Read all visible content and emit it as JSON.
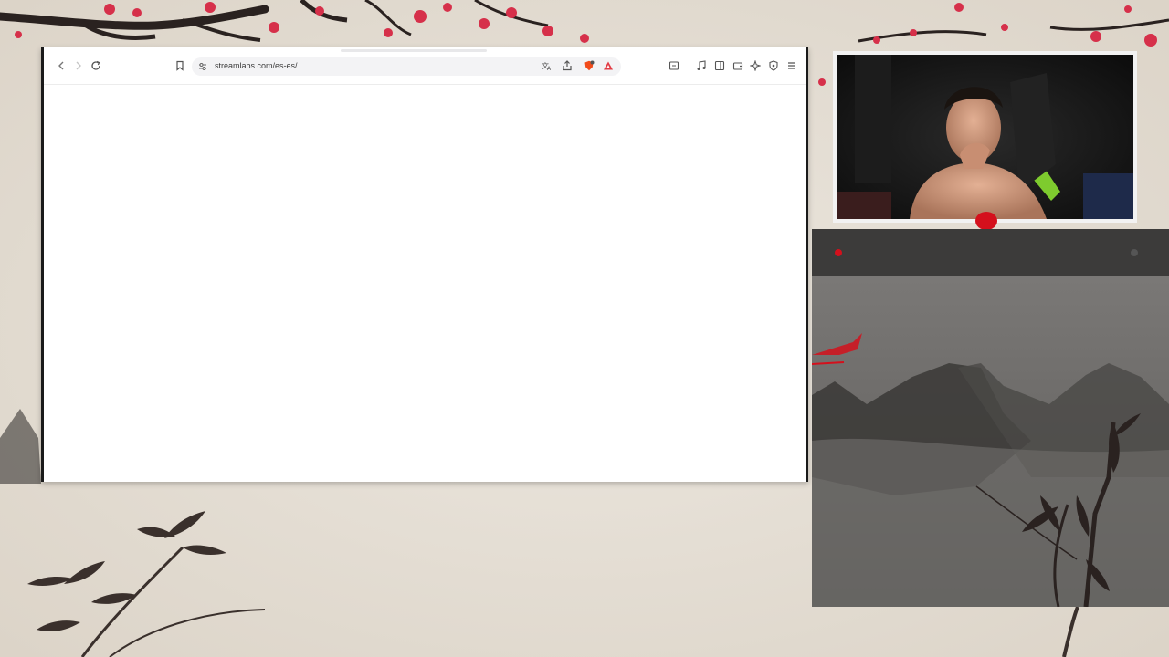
{
  "browser": {
    "url": "streamlabs.com/es-es/",
    "toolbar_icons": {
      "back": "chevron-left-icon",
      "forward": "chevron-right-icon",
      "reload": "reload-icon",
      "bookmark": "bookmark-icon",
      "site_settings": "tune-icon",
      "translate": "translate-icon",
      "share": "share-icon",
      "shields": "brave-shield-icon",
      "rewards": "brave-rewards-icon",
      "cast": "cast-icon",
      "media": "music-note-icon",
      "sidebar": "sidebar-icon",
      "wallet": "wallet-icon",
      "leo": "sparkle-icon",
      "vpn": "vpn-shield-icon",
      "menu": "hamburger-menu-icon"
    }
  },
  "colors": {
    "accent_red": "#d4101c",
    "brave_orange": "#f24b1a",
    "panel_dark": "#3c3b3a",
    "panel_mid": "#6e6c6a",
    "paper": "#e6e0d7",
    "blossom": "#d6304a",
    "ink": "#2a2220"
  }
}
